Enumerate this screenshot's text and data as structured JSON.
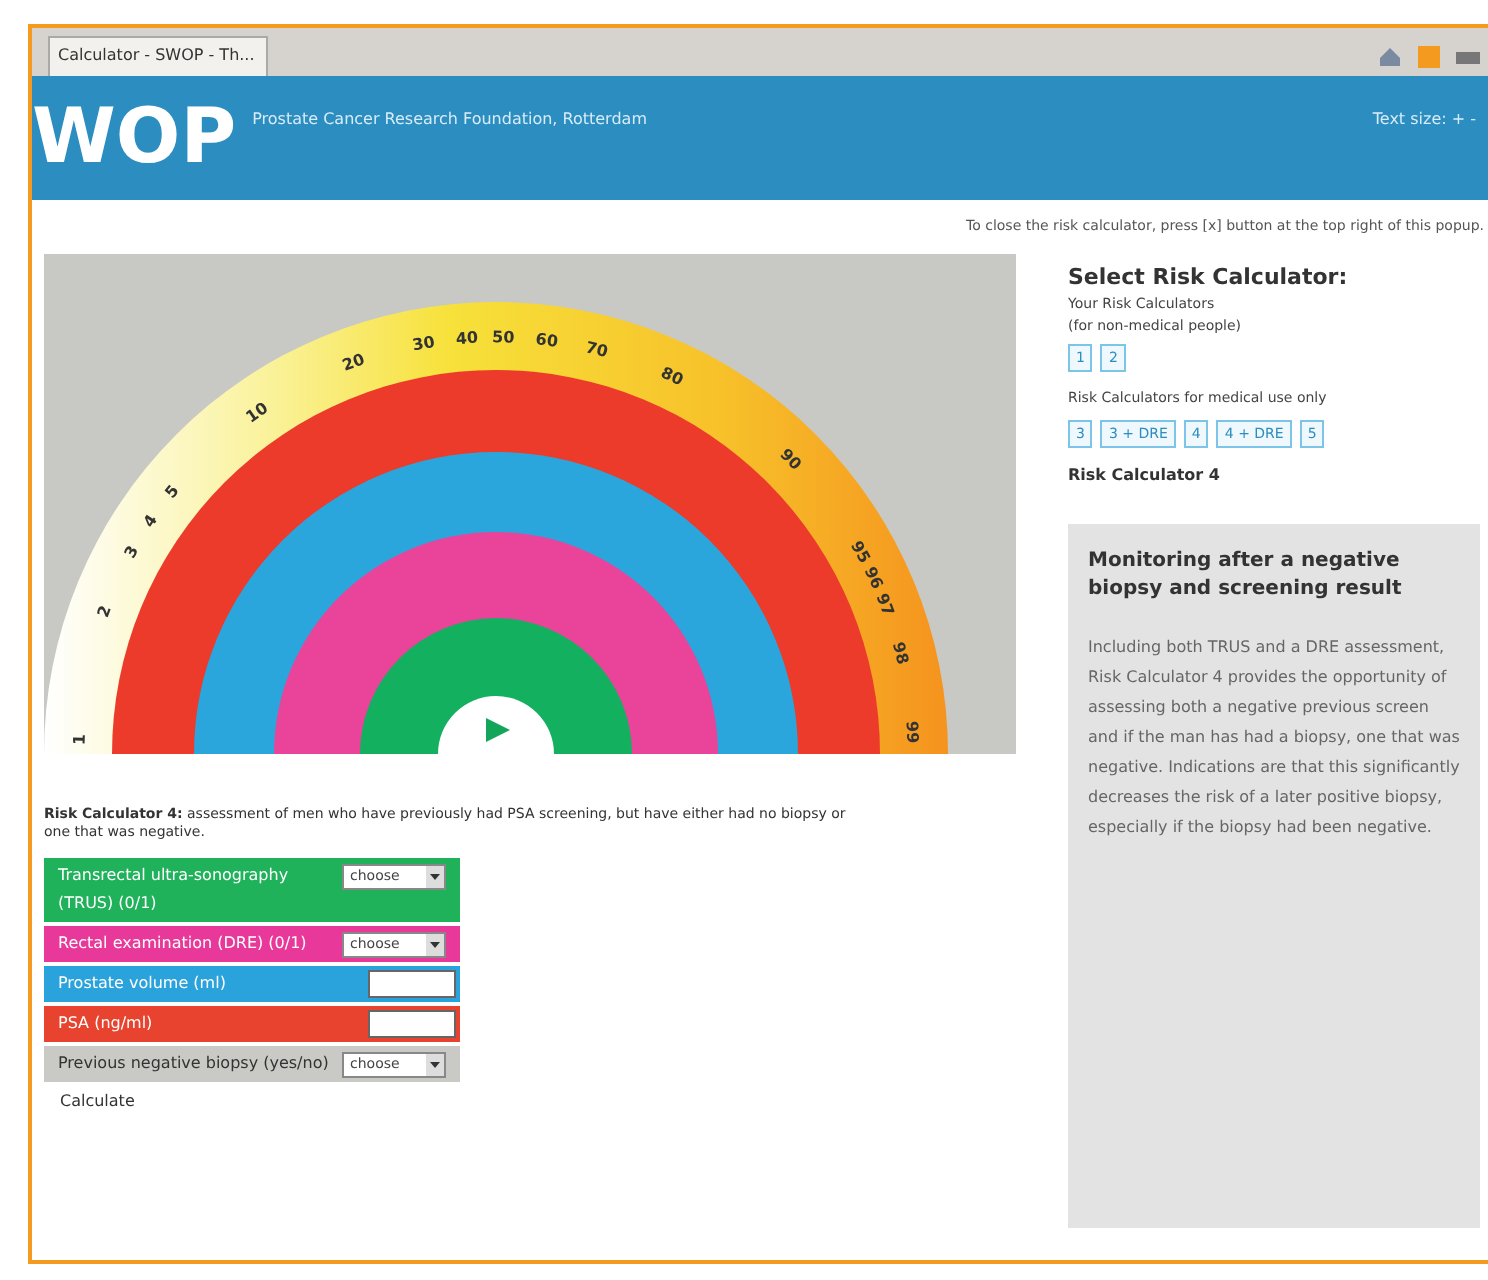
{
  "browser": {
    "tab_title": "Calculator - SWOP - Th..."
  },
  "header": {
    "logo": "WOP",
    "title": "Prostate Cancer Research Foundation, Rotterdam",
    "text_size": "Text size: + -"
  },
  "notice": "To close the risk calculator, press [x] button at the top right of this popup.",
  "gauge": {
    "scale_labels": [
      "1",
      "2",
      "3",
      "4",
      "5",
      "10",
      "20",
      "30",
      "40",
      "50",
      "60",
      "70",
      "80",
      "90",
      "95",
      "96",
      "97",
      "98",
      "99"
    ]
  },
  "intro": "**Risk Calculator 4:** assessment of men who have previously had PSA screening, but have either had no biopsy or one that was negative.",
  "form": {
    "fields": [
      {
        "label": "Transrectal ultra-sonography (TRUS) (0/1)",
        "kind": "select",
        "value": "choose",
        "color": "#1fb25a"
      },
      {
        "label": "Rectal examination (DRE) (0/1)",
        "kind": "select",
        "value": "choose",
        "color": "#e8399a"
      },
      {
        "label": "Prostate volume (ml)",
        "kind": "input",
        "color": "#2aa3dc"
      },
      {
        "label": "PSA (ng/ml)",
        "kind": "input",
        "color": "#e8432f"
      },
      {
        "label": "Previous negative biopsy (yes/no)",
        "kind": "select",
        "value": "choose",
        "color": "#c9c9c6"
      }
    ],
    "submit": "Calculate"
  },
  "sidebar": {
    "title": "Select Risk Calculator:",
    "group1_title": "Your Risk Calculators",
    "group1_note": "(for non-medical people)",
    "group1_buttons": [
      "1",
      "2"
    ],
    "group2_title": "Risk Calculators for medical use only",
    "group2_buttons": [
      "3",
      "3 + DRE",
      "4",
      "4 + DRE",
      "5"
    ],
    "current": "Risk Calculator 4",
    "info_title": "Monitoring after a negative biopsy and screening result",
    "info_text": "Including both TRUS and a DRE assessment, Risk Calculator 4 provides the opportunity of assessing both a negative previous screen and if the man has had a biopsy, one that was negative. Indications are that this significantly decreases the risk of a later positive biopsy, especially if the biopsy had been negative."
  }
}
